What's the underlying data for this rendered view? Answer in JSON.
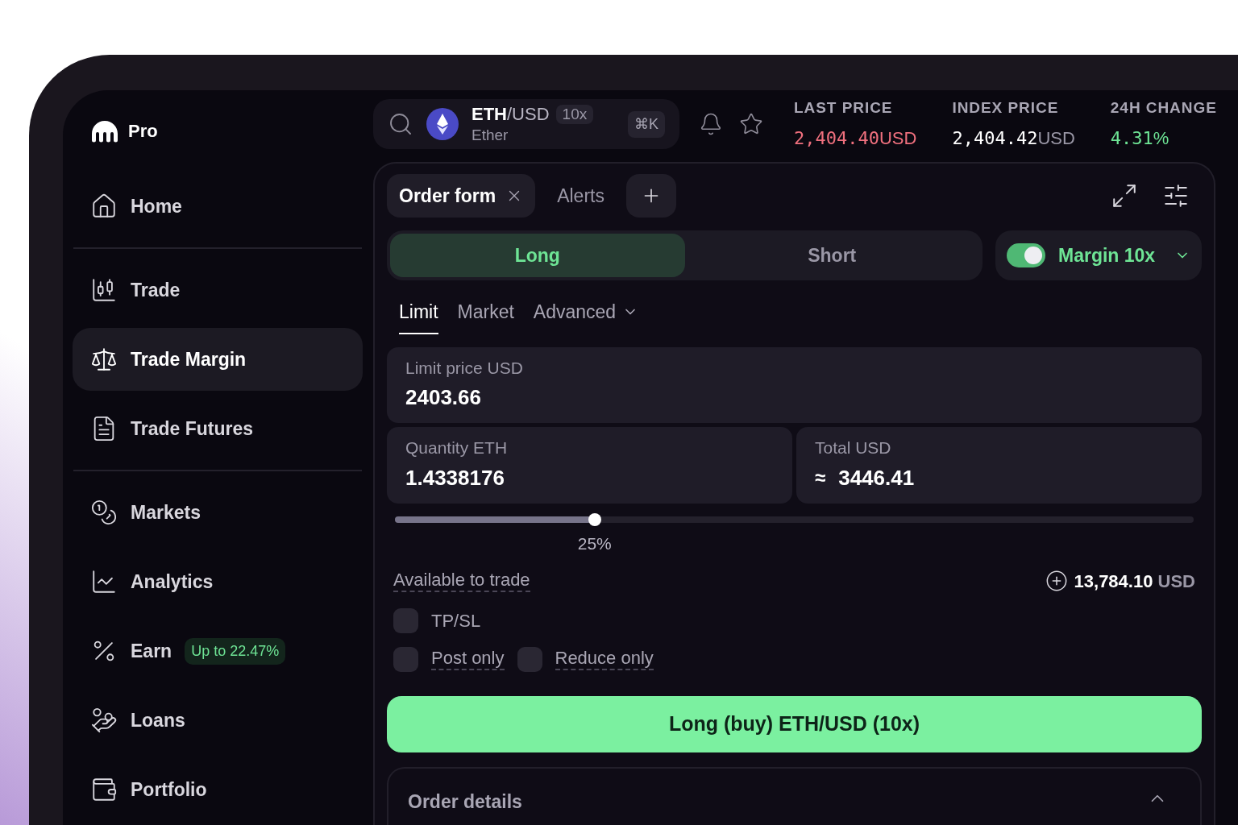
{
  "brand": {
    "name": "Pro"
  },
  "sidebar": {
    "groups": [
      {
        "items": [
          {
            "label": "Home",
            "selected": false
          }
        ]
      },
      {
        "items": [
          {
            "label": "Trade",
            "selected": false
          },
          {
            "label": "Trade Margin",
            "selected": true
          },
          {
            "label": "Trade Futures",
            "selected": false
          }
        ]
      },
      {
        "items": [
          {
            "label": "Markets",
            "selected": false
          },
          {
            "label": "Analytics",
            "selected": false
          },
          {
            "label": "Earn",
            "selected": false,
            "badge": "Up to 22.47%"
          },
          {
            "label": "Loans",
            "selected": false
          },
          {
            "label": "Portfolio",
            "selected": false
          }
        ]
      }
    ]
  },
  "market": {
    "base": "ETH",
    "quote": "/USD",
    "leverage": "10x",
    "name": "Ether",
    "shortcut": "⌘K"
  },
  "stats": [
    {
      "label": "LAST PRICE",
      "value": "2,404.40",
      "unit": "USD",
      "color": "#f0707e",
      "unit_muted": false
    },
    {
      "label": "INDEX PRICE",
      "value": "2,404.42",
      "unit": "USD",
      "color": "#ffffff",
      "unit_muted": true
    },
    {
      "label": "24H CHANGE",
      "value": "4.31",
      "unit": "%",
      "color": "#6ee495",
      "unit_muted": false
    }
  ],
  "panel": {
    "tabs": [
      {
        "label": "Order form",
        "selected": true,
        "closable": true
      },
      {
        "label": "Alerts",
        "selected": false,
        "closable": false
      }
    ],
    "sides": [
      {
        "label": "Long",
        "selected": true
      },
      {
        "label": "Short",
        "selected": false
      }
    ],
    "margin": {
      "on": true,
      "label": "Margin 10x"
    },
    "order_types": [
      {
        "label": "Limit",
        "selected": true,
        "dropdown": false
      },
      {
        "label": "Market",
        "selected": false,
        "dropdown": false
      },
      {
        "label": "Advanced",
        "selected": false,
        "dropdown": true
      }
    ],
    "limit_price": {
      "label": "Limit price USD",
      "value": "2403.66"
    },
    "quantity": {
      "label": "Quantity ETH",
      "value": "1.4338176"
    },
    "total": {
      "label": "Total USD",
      "prefix": "≈",
      "value": "3446.41"
    },
    "slider": {
      "level": 0.25,
      "reading": "25%"
    },
    "available": {
      "label": "Available to trade",
      "value": "13,784.10",
      "unit": "USD"
    },
    "options": [
      [
        {
          "label": "TP/SL",
          "checked": false,
          "underlined": false
        }
      ],
      [
        {
          "label": "Post only",
          "checked": false,
          "underlined": true
        },
        {
          "label": "Reduce only",
          "checked": false,
          "underlined": true
        }
      ]
    ],
    "submit": "Long (buy) ETH/USD (10x)",
    "order_details": {
      "title": "Order details",
      "expanded": true
    }
  }
}
